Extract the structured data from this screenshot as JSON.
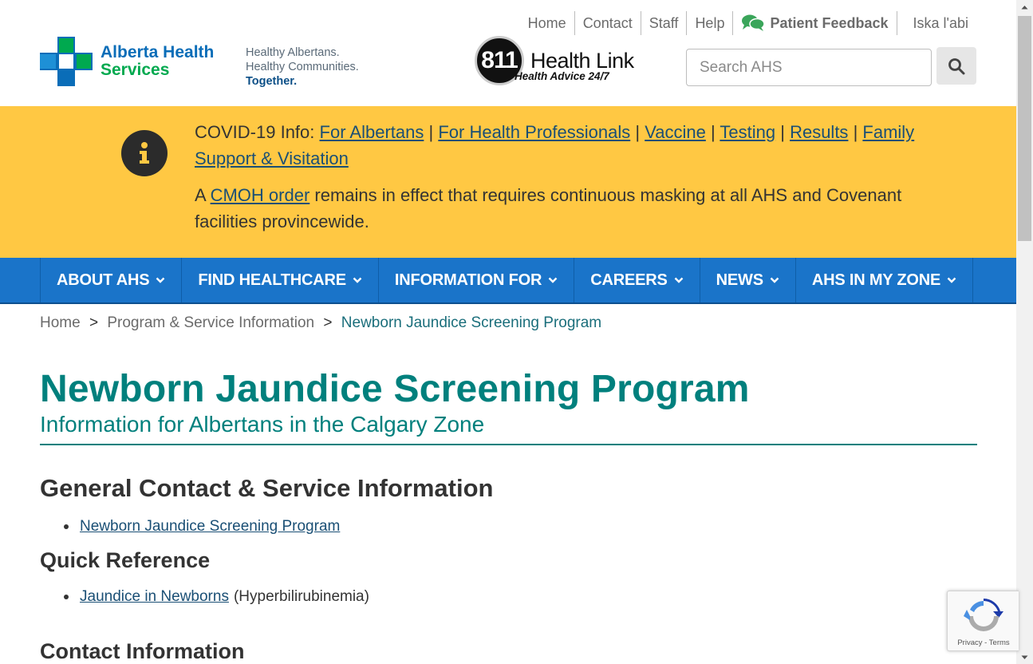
{
  "util_nav": {
    "items": [
      "Home",
      "Contact",
      "Staff",
      "Help"
    ],
    "feedback_label": "Patient Feedback",
    "language_label": "Iska l'abi"
  },
  "logo": {
    "line1": "Alberta Health",
    "line2": "Services",
    "tagline1": "Healthy Albertans.",
    "tagline2": "Healthy Communities.",
    "tagline3": "Together."
  },
  "healthlink": {
    "number": "811",
    "title": "Health Link",
    "subtitle": "Health Advice 24/7"
  },
  "search": {
    "placeholder": "Search AHS"
  },
  "alert": {
    "prefix": "COVID-19 Info:",
    "links": [
      "For Albertans",
      "For Health Professionals",
      "Vaccine",
      "Testing",
      "Results",
      "Family Support & Visitation"
    ],
    "separator": "|",
    "p2_start": "A",
    "p2_link": "CMOH order",
    "p2_rest": "remains in effect that requires continuous masking at all AHS and Covenant facilities provincewide."
  },
  "main_nav": {
    "items": [
      "ABOUT AHS",
      "FIND HEALTHCARE",
      "INFORMATION FOR",
      "CAREERS",
      "NEWS",
      "AHS IN MY ZONE"
    ]
  },
  "breadcrumb": {
    "items": [
      "Home",
      "Program & Service Information"
    ],
    "current": "Newborn Jaundice Screening Program",
    "separator": ">"
  },
  "page": {
    "title": "Newborn Jaundice Screening Program",
    "subtitle": "Information for Albertans in the Calgary Zone"
  },
  "sections": {
    "general_heading": "General Contact & Service Information",
    "general_link": "Newborn Jaundice Screening Program",
    "quick_heading": "Quick Reference",
    "quick_link": "Jaundice in Newborns",
    "quick_suffix": "(Hyperbilirubinemia)",
    "contact_heading": "Contact Information"
  },
  "recaptcha": {
    "privacy": "Privacy",
    "dash": " - ",
    "terms": "Terms"
  },
  "colors": {
    "alert_bg": "#ffc843",
    "nav_bg": "#1a74c9",
    "title_teal": "#00807d",
    "link": "#1a4f75",
    "brand_blue": "#0a6db8",
    "brand_green": "#00a94f"
  }
}
